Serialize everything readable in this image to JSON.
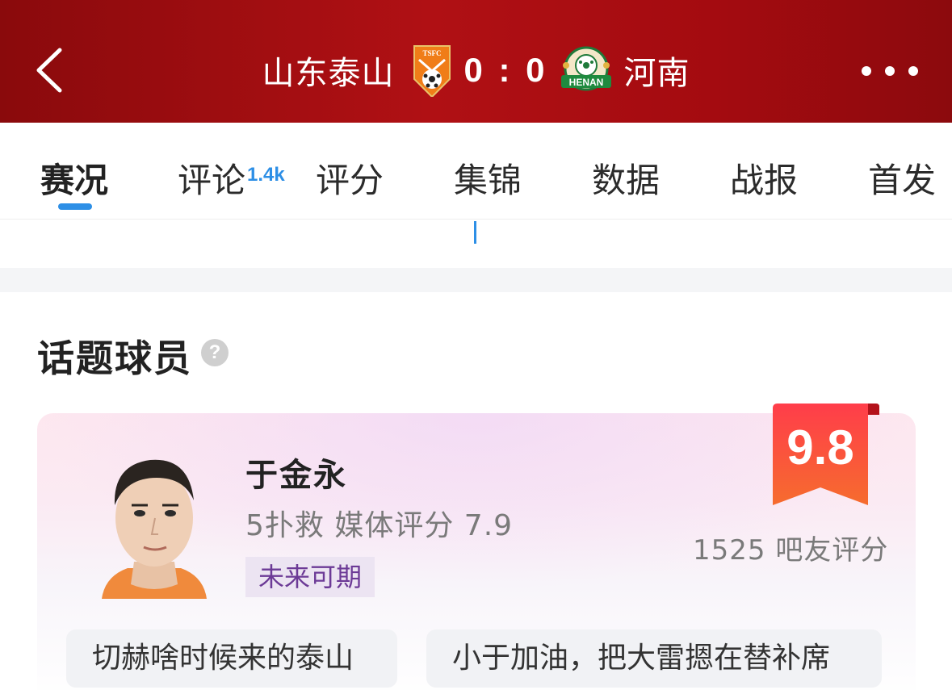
{
  "header": {
    "home_team": "山东泰山",
    "away_team": "河南",
    "score": "0 : 0",
    "home_logo_text": "TSFC",
    "away_logo_text": "HENAN"
  },
  "tabs": [
    {
      "label": "赛况",
      "active": true
    },
    {
      "label": "评论",
      "badge": "1.4k"
    },
    {
      "label": "评分"
    },
    {
      "label": "集锦"
    },
    {
      "label": "数据"
    },
    {
      "label": "战报"
    },
    {
      "label": "首发"
    }
  ],
  "section": {
    "title": "话题球员",
    "help": "?"
  },
  "player_card": {
    "name": "于金永",
    "stats": "5扑救  媒体评分 7.9",
    "tag": "未来可期",
    "rating": "9.8",
    "fan_count": "1525 吧友评分",
    "comments": [
      "切赫啥时候来的泰山",
      "小于加油，把大雷摁在替补席"
    ]
  },
  "colors": {
    "header_red": "#b01014",
    "accent_blue": "#2d8fe6",
    "rating_orange": "#f24b3a",
    "tag_purple": "#6c3a96"
  },
  "icons": {
    "back": "chevron-left-icon",
    "more": "more-dots-icon",
    "help": "help-circle-icon"
  }
}
